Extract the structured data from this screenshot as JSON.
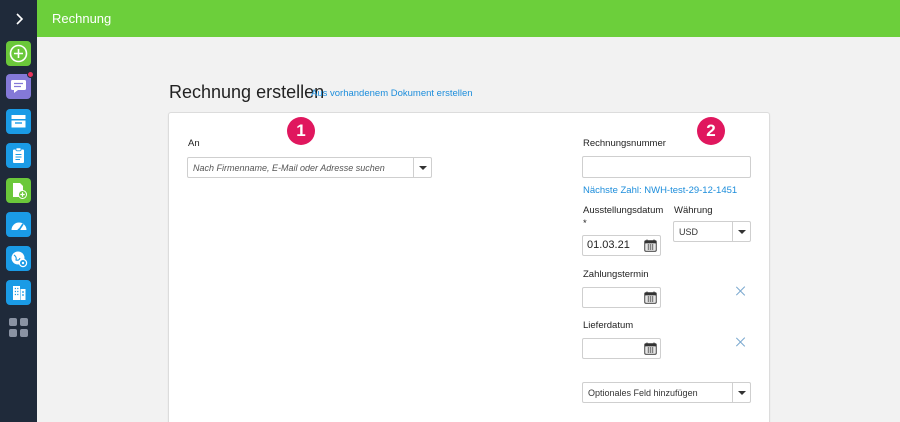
{
  "topbar": {
    "title": "Rechnung"
  },
  "page": {
    "title": "Rechnung erstellen",
    "link": "Aus vorhandenem Dokument erstellen"
  },
  "badges": {
    "one": "1",
    "two": "2"
  },
  "recipient": {
    "label": "An",
    "placeholder": "Nach Firmenname, E-Mail oder Adresse suchen"
  },
  "invoice": {
    "number_label": "Rechnungsnummer",
    "number_value": "",
    "next_number": "Nächste Zahl: NWH-test-29-12-1451",
    "issue_date_label": "Ausstellungsdatum",
    "required_mark": "*",
    "issue_date_value": "01.03.21",
    "currency_label": "Währung",
    "currency_value": "USD",
    "due_date_label": "Zahlungstermin",
    "due_date_value": "",
    "delivery_date_label": "Lieferdatum",
    "delivery_date_value": "",
    "optional_field": "Optionales Feld hinzufügen"
  },
  "icons": {
    "sidebar": [
      "chevron-right-icon",
      "plus-circle-icon",
      "chat-icon",
      "inbox-icon",
      "clipboard-icon",
      "document-add-icon",
      "dashboard-icon",
      "globe-settings-icon",
      "building-icon",
      "apps-grid-icon"
    ],
    "calendar": "calendar-icon",
    "clear": "close-icon"
  },
  "colors": {
    "topbar": "#6ccf3b",
    "sidebar": "#1f2a3a",
    "accent_link": "#1c8ddb",
    "badge": "#e0175e",
    "sidebar_green": "#6bc83a",
    "sidebar_blue": "#1a9be6",
    "sidebar_purple": "#8479d8"
  }
}
